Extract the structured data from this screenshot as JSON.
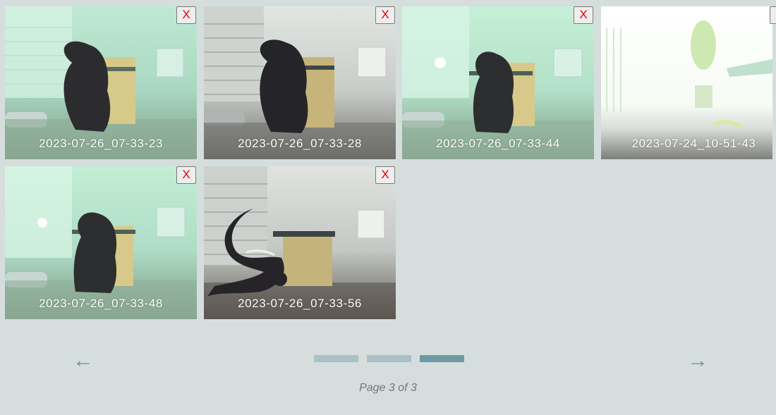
{
  "gallery": {
    "cards": [
      {
        "timestamp": "2023-07-26_07-33-23",
        "delete_label": "X",
        "subject": "squirrel-at-feeder"
      },
      {
        "timestamp": "2023-07-26_07-33-28",
        "delete_label": "X",
        "subject": "squirrel-at-feeder"
      },
      {
        "timestamp": "2023-07-26_07-33-44",
        "delete_label": "X",
        "subject": "squirrel-at-feeder"
      },
      {
        "timestamp": "2023-07-24_10-51-43",
        "delete_label": "X",
        "subject": "overexposed-patio"
      },
      {
        "timestamp": "2023-07-26_07-33-48",
        "delete_label": "X",
        "subject": "squirrel-at-feeder"
      },
      {
        "timestamp": "2023-07-26_07-33-56",
        "delete_label": "X",
        "subject": "squirrel-at-feeder"
      }
    ]
  },
  "pagination": {
    "prev_arrow": "←",
    "next_arrow": "→",
    "current_page": 3,
    "total_pages": 3,
    "page_text": "Page 3 of 3"
  },
  "colors": {
    "background": "#d6dedd",
    "dot_inactive": "#aac1c5",
    "dot_active": "#6d99a2",
    "arrow": "#6e8f97",
    "delete_text": "#e00000"
  }
}
